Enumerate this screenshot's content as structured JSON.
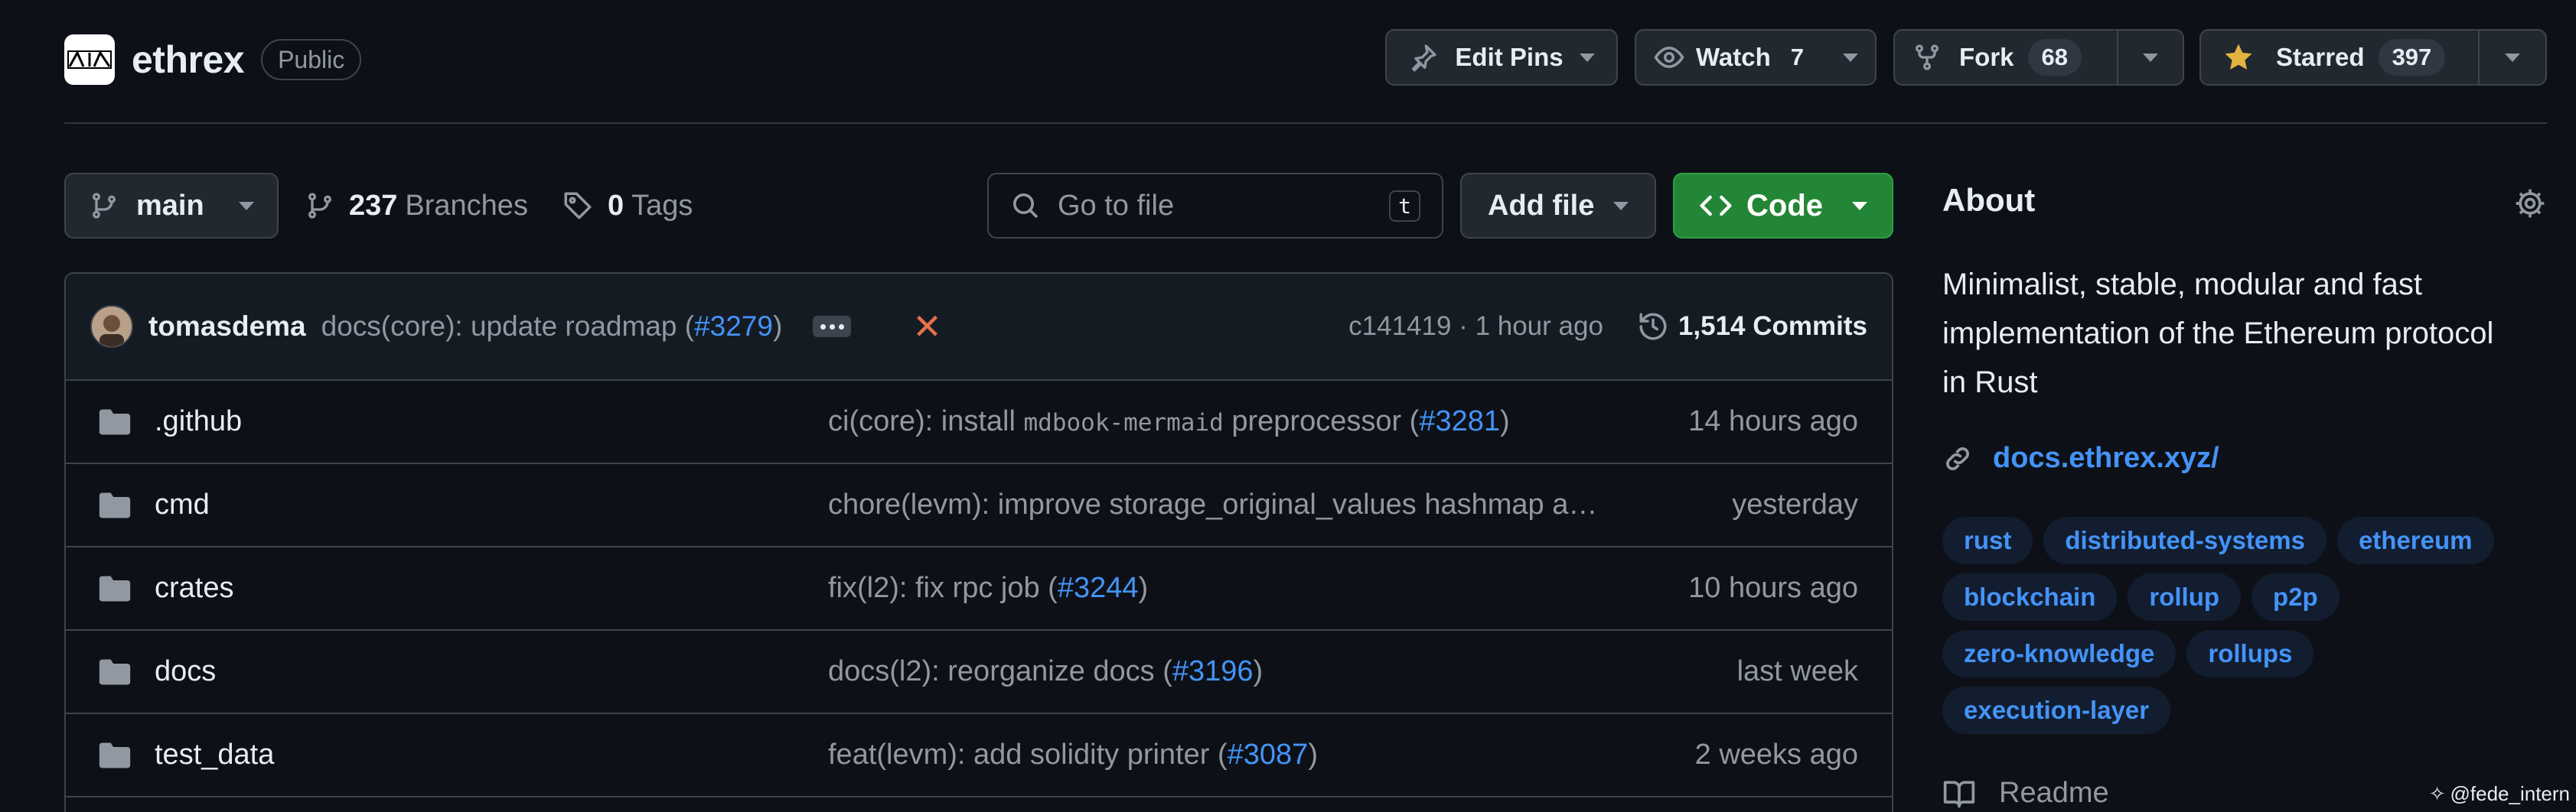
{
  "repo": {
    "logo_text": "LAMBDA",
    "name": "ethrex",
    "visibility": "Public"
  },
  "actions": {
    "edit_pins": "Edit Pins",
    "watch": {
      "label": "Watch",
      "count": "7"
    },
    "fork": {
      "label": "Fork",
      "count": "68"
    },
    "star": {
      "label": "Starred",
      "count": "397"
    }
  },
  "toolbar": {
    "branch": "main",
    "branches_count": "237",
    "branches_label": "Branches",
    "tags_count": "0",
    "tags_label": "Tags",
    "search_placeholder": "Go to file",
    "search_shortcut": "t",
    "add_file": "Add file",
    "code": "Code"
  },
  "latest_commit": {
    "author": "tomasdema",
    "message_prefix": "docs(core): update roadmap (",
    "pr": "#3279",
    "message_suffix": ")",
    "sha": "c141419",
    "separator": " · ",
    "time": "1 hour ago",
    "commits_label": "1,514 Commits"
  },
  "files": [
    {
      "name": ".github",
      "msg_parts": [
        "ci(core): install ",
        "mdbook-mermaid",
        " preprocessor (",
        "#3281",
        ")"
      ],
      "time": "14 hours ago"
    },
    {
      "name": "cmd",
      "msg_parts": [
        "chore(levm): improve storage_original_values hashmap and add some comments",
        "",
        "",
        "",
        ""
      ],
      "time": "yesterday"
    },
    {
      "name": "crates",
      "msg_parts": [
        "fix(l2): fix rpc job (",
        "",
        "",
        "#3244",
        ")"
      ],
      "time": "10 hours ago"
    },
    {
      "name": "docs",
      "msg_parts": [
        "docs(l2): reorganize docs (",
        "",
        "",
        "#3196",
        ")"
      ],
      "time": "last week"
    },
    {
      "name": "test_data",
      "msg_parts": [
        "feat(levm): add solidity printer (",
        "",
        "",
        "#3087",
        ")"
      ],
      "time": "2 weeks ago"
    }
  ],
  "about": {
    "title": "About",
    "description": "Minimalist, stable, modular and fast implementation of the Ethereum protocol in Rust",
    "homepage": "docs.ethrex.xyz/",
    "topics": [
      "rust",
      "distributed-systems",
      "ethereum",
      "blockchain",
      "rollup",
      "p2p",
      "zero-knowledge",
      "rollups",
      "execution-layer"
    ],
    "readme": "Readme"
  },
  "watermark": "@fede_intern",
  "colors": {
    "bg": "#0d1117",
    "accent_link": "#4493f8",
    "code_button": "#238636",
    "star": "#e3b341",
    "failure": "#e5704b"
  },
  "icons": [
    "pin-icon",
    "eye-icon",
    "fork-icon",
    "star-icon",
    "git-branch-icon",
    "tag-icon",
    "search-icon",
    "code-icon",
    "history-icon",
    "folder-icon",
    "gear-icon",
    "link-icon",
    "book-icon"
  ]
}
